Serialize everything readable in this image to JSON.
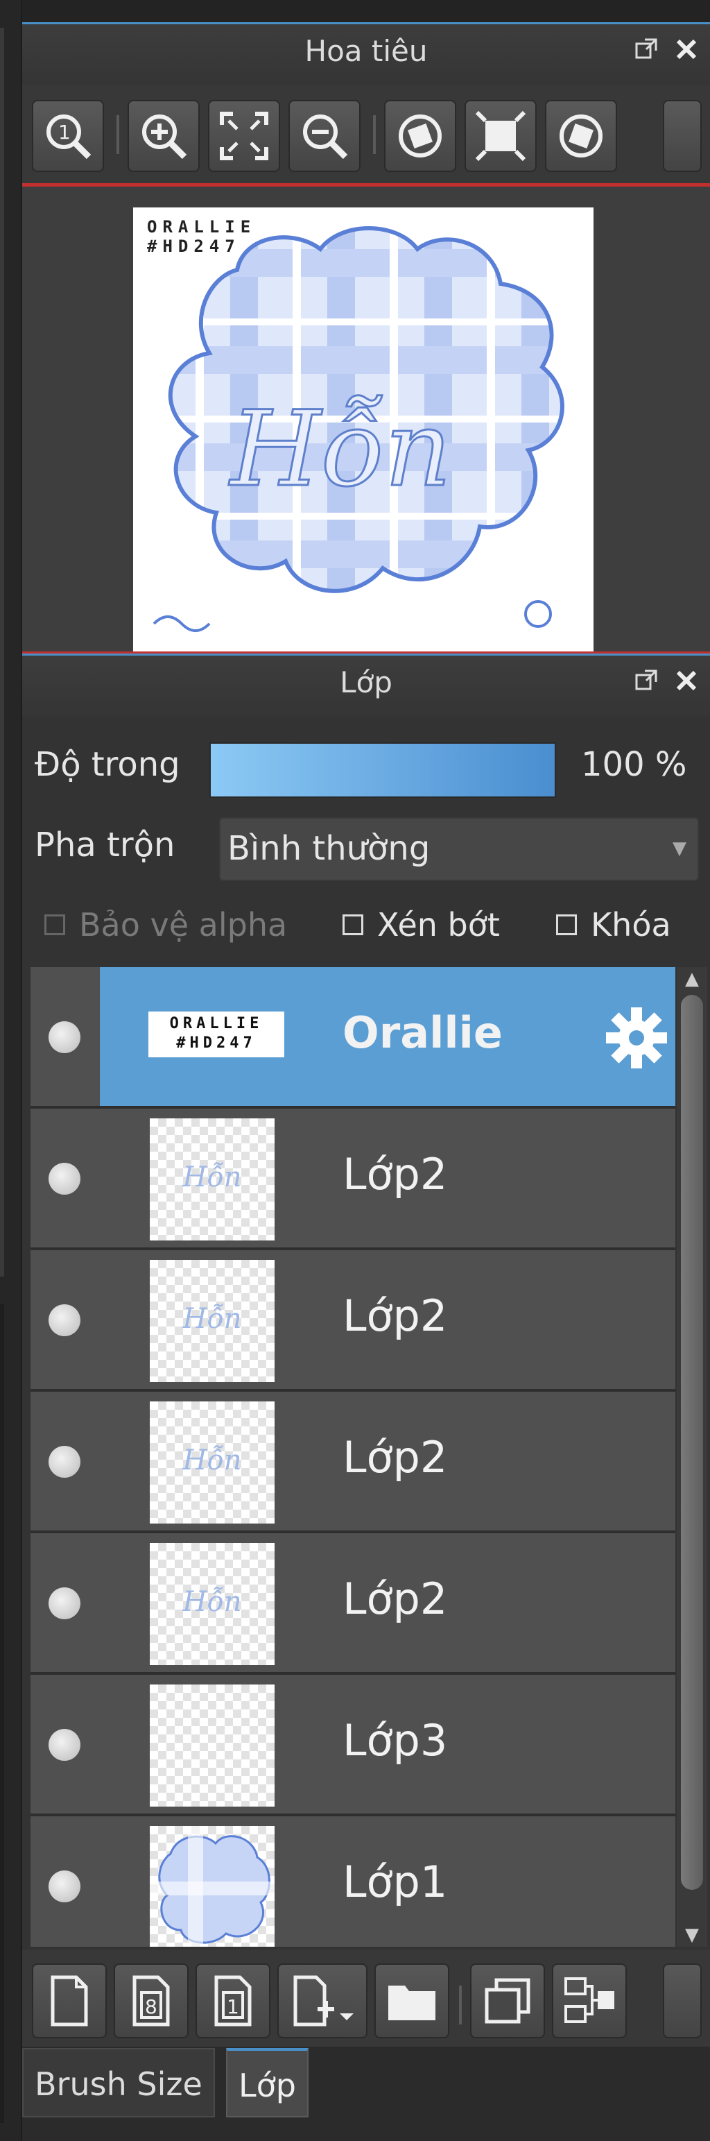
{
  "navigator": {
    "title": "Hoa tiêu",
    "toolbar": [
      "zoom-reset-icon",
      "zoom-in-icon",
      "fit-screen-icon",
      "zoom-out-icon",
      "rotate-left-icon",
      "fullscreen-icon",
      "rotate-right-icon"
    ],
    "canvas": {
      "watermark_line1": "ORALLIE",
      "watermark_line2": "#HD247",
      "center_text": "Hỗn"
    }
  },
  "layers_panel": {
    "title": "Lớp",
    "opacity_label": "Độ trong",
    "opacity_value": "100 %",
    "opacity_fraction": 1.0,
    "blend_label": "Pha trộn",
    "blend_value": "Bình thường",
    "checkboxes": {
      "protect_alpha": "Bảo vệ alpha",
      "clip": "Xén bớt",
      "lock": "Khóa"
    },
    "layers": [
      {
        "name": "Orallie",
        "thumb_line1": "ORALLIE",
        "thumb_line2": "#HD247",
        "active": true
      },
      {
        "name": "Lớp2",
        "thumb_text": "Hỗn"
      },
      {
        "name": "Lớp2",
        "thumb_text": "Hỗn"
      },
      {
        "name": "Lớp2",
        "thumb_text": "Hỗn"
      },
      {
        "name": "Lớp2",
        "thumb_text": "Hỗn"
      },
      {
        "name": "Lớp3",
        "thumb_text": ""
      },
      {
        "name": "Lớp1",
        "thumb_text": ""
      }
    ],
    "bottom_toolbar": [
      "new-layer-icon",
      "new-8bit-layer-icon",
      "new-1bit-layer-icon",
      "add-layer-menu-icon",
      "new-folder-icon",
      "duplicate-layer-icon",
      "merge-layer-icon"
    ]
  },
  "tabs": {
    "brush_size": "Brush Size",
    "layers": "Lớp"
  },
  "colors": {
    "accent": "#4a90c8",
    "active_layer": "#5a9ed4",
    "red_line": "#c23030"
  }
}
